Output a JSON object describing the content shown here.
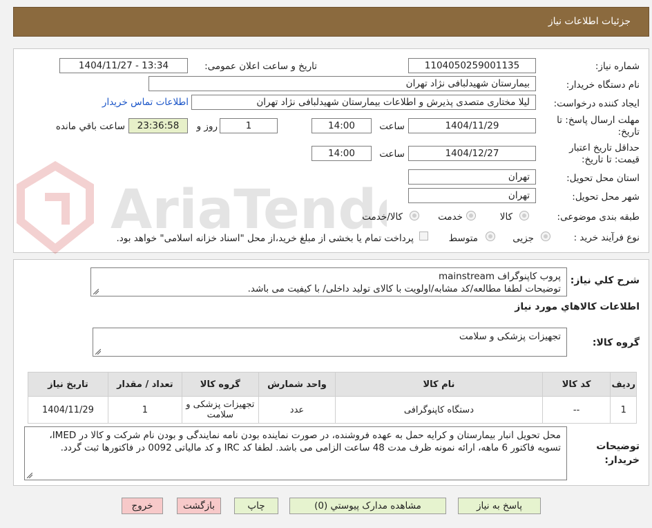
{
  "header": {
    "title": "جزئیات اطلاعات نیاز"
  },
  "watermark": {
    "text": "AriaTender.neT"
  },
  "fields": {
    "need_number_label": "شماره نیاز:",
    "need_number": "1104050259001135",
    "announce_label": "تاریخ و ساعت اعلان عمومی:",
    "announce_value": "1404/11/27 - 13:34",
    "buyer_org_label": "نام دستگاه خریدار:",
    "buyer_org": "بیمارستان شهیدلبافی نژاد تهران",
    "requester_label": "ایجاد کننده درخواست:",
    "requester": "لیلا مختاری متصدی پذیرش و اطلاعات بیمارستان شهیدلبافی نژاد تهران",
    "buyer_contact_link": "اطلاعات تماس خریدار",
    "reply_deadline_label": "مهلت ارسال پاسخ: تا تاریخ:",
    "reply_date": "1404/11/29",
    "time_label": "ساعت",
    "reply_time": "14:00",
    "days_value": "1",
    "days_label": "روز و",
    "remaining_time": "23:36:58",
    "remaining_label": "ساعت باقي مانده",
    "price_validity_label": "حداقل تاریخ اعتبار قیمت: تا تاریخ:",
    "price_date": "1404/12/27",
    "price_time": "14:00",
    "province_label": "استان محل تحویل:",
    "province": "تهران",
    "city_label": "شهر محل تحویل:",
    "city": "تهران",
    "category_label": "طبقه بندی موضوعی:",
    "category_goods": "کالا",
    "category_service": "خدمت",
    "category_both": "کالا/خدمت",
    "process_label": "نوع فرآیند خرید :",
    "process_partial": "جزیی",
    "process_medium": "متوسط",
    "payment_note": "پرداخت تمام یا بخشی از مبلغ خرید،از محل \"اسناد خزانه اسلامی\" خواهد بود."
  },
  "summary": {
    "label": "شرح کلي نیاز:",
    "line1": "پروب کاپنوگراف mainstream",
    "line2": "توضیحات لطفا مطالعه/کد مشابه/اولویت با کالای تولید داخلی/ با کیفیت می باشد."
  },
  "goods_section": {
    "title": "اطلاعات کالاهاي مورد نیاز",
    "group_label": "گروه کالا:",
    "group_value": "تجهیزات پزشکی و سلامت"
  },
  "table": {
    "headers": [
      "ردیف",
      "کد کالا",
      "نام کالا",
      "واحد شمارش",
      "گروه کالا",
      "تعداد / مقدار",
      "تاریخ نیاز"
    ],
    "rows": [
      [
        "1",
        "--",
        "دستگاه کاپنوگرافی",
        "عدد",
        "تجهیزات پزشکی و سلامت",
        "1",
        "1404/11/29"
      ]
    ]
  },
  "buyer_notes": {
    "label": "توضیحات خریدار:",
    "text": "محل تحویل انبار بیمارستان و کرایه حمل به عهده فروشنده، در صورت نماینده بودن نامه نمایندگی و بودن نام شرکت و کالا در IMED، تسویه فاکتور 6 ماهه، ارائه نمونه ظرف مدت 48 ساعت الزامی می باشد. لطفا کد IRC و کد مالیاتی 0092 در فاکتورها ثبت گردد."
  },
  "buttons": {
    "reply": "پاسخ به نیاز",
    "attachments": "مشاهده مدارک پیوستي (0)",
    "print": "چاپ",
    "back": "بازگشت",
    "exit": "خروج"
  }
}
